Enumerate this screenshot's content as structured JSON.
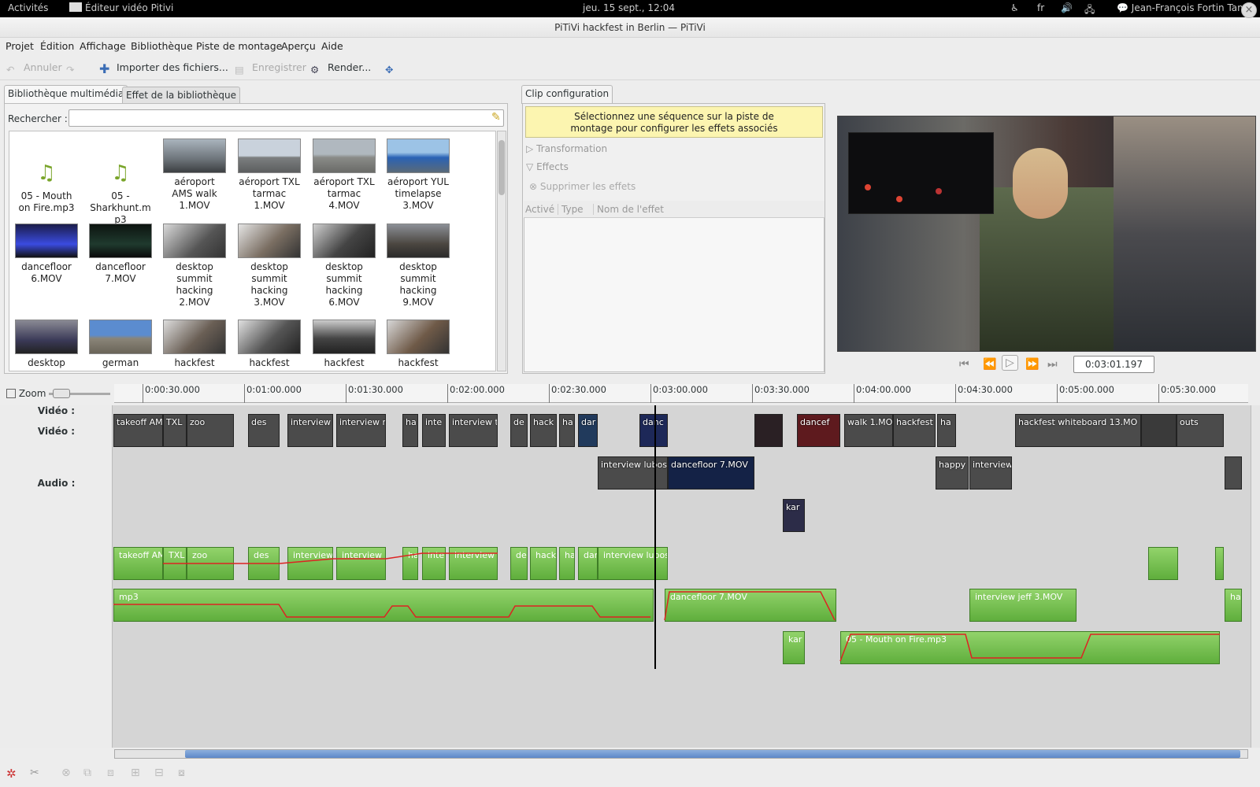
{
  "topbar": {
    "activities": "Activités",
    "app_name": "Éditeur vidéo Pitivi",
    "clock": "jeu. 15 sept., 12:04",
    "lang": "fr",
    "user": "Jean-François Fortin Tam"
  },
  "window": {
    "title": "PiTiVi hackfest in Berlin — PiTiVi"
  },
  "menu": [
    "Projet",
    "Édition",
    "Affichage",
    "Bibliothèque",
    "Piste de montage",
    "Aperçu",
    "Aide"
  ],
  "toolbar": {
    "undo": "Annuler",
    "import": "Importer des fichiers...",
    "save": "Enregistrer",
    "render": "Render..."
  },
  "library": {
    "tabs": [
      "Bibliothèque multimédia",
      "Effet de la bibliothèque"
    ],
    "search_label": "Rechercher :",
    "search_value": "",
    "items": [
      [
        "05 - Mouth",
        "on Fire.mp3"
      ],
      [
        "05 -",
        "Sharkhunt.m",
        "p3"
      ],
      [
        "aéroport",
        "AMS walk",
        "1.MOV"
      ],
      [
        "aéroport TXL",
        "tarmac",
        "1.MOV"
      ],
      [
        "aéroport TXL",
        "tarmac",
        "4.MOV"
      ],
      [
        "aéroport YUL",
        "timelapse",
        "3.MOV"
      ],
      [
        "dancefloor",
        "6.MOV"
      ],
      [
        "dancefloor",
        "7.MOV"
      ],
      [
        "desktop",
        "summit",
        "hacking",
        "2.MOV"
      ],
      [
        "desktop",
        "summit",
        "hacking",
        "3.MOV"
      ],
      [
        "desktop",
        "summit",
        "hacking",
        "6.MOV"
      ],
      [
        "desktop",
        "summit",
        "hacking",
        "9.MOV"
      ],
      [
        "desktop"
      ],
      [
        "german"
      ],
      [
        "hackfest"
      ],
      [
        "hackfest"
      ],
      [
        "hackfest"
      ],
      [
        "hackfest"
      ]
    ]
  },
  "clip_config": {
    "tab": "Clip configuration",
    "message_l1": "Sélectionnez une séquence sur la piste de",
    "message_l2": "montage pour configurer les effets associés",
    "transformation": "Transformation",
    "effects": "Effects",
    "remove_effects": "Supprimer les effets",
    "columns": [
      "Activé",
      "Type",
      "Nom de l'effet"
    ]
  },
  "viewer": {
    "timecode": "0:03:01.197"
  },
  "timeline": {
    "zoom_label": "Zoom",
    "ticks": [
      "0:00:30.000",
      "0:01:00.000",
      "0:01:30.000",
      "0:02:00.000",
      "0:02:30.000",
      "0:03:00.000",
      "0:03:30.000",
      "0:04:00.000",
      "0:04:30.000",
      "0:05:00.000",
      "0:05:30.000"
    ],
    "track_video": "Vidéo :",
    "track_audio": "Audio :",
    "video_clips": [
      "takeoff AM",
      "TXL",
      "zoo",
      "des",
      "interview",
      "interview m",
      "ha",
      "inte",
      "interview t",
      "de",
      "hack",
      "ha",
      "dar",
      "danc",
      "dancef",
      "walk 1.MO",
      "hackfest",
      "ha",
      "hackfest whiteboard 13.MO",
      "outs"
    ],
    "video_clips2": [
      "interview lubos",
      "dancefloor 7.MOV",
      "happy",
      "interview",
      "kar"
    ],
    "audio_clips": [
      "takeoff AM",
      "TXL",
      "zoo",
      "des",
      "interview",
      "interview m",
      "ha",
      "inte",
      "interview t",
      "de",
      "hack",
      "ha",
      "dar",
      "interview lubos"
    ],
    "audio_clips2": [
      "mp3",
      "dancefloor 7.MOV",
      "interview jeff 3.MOV",
      "ha"
    ],
    "audio_clips3": [
      "kar",
      "05 - Mouth on Fire.mp3"
    ]
  }
}
